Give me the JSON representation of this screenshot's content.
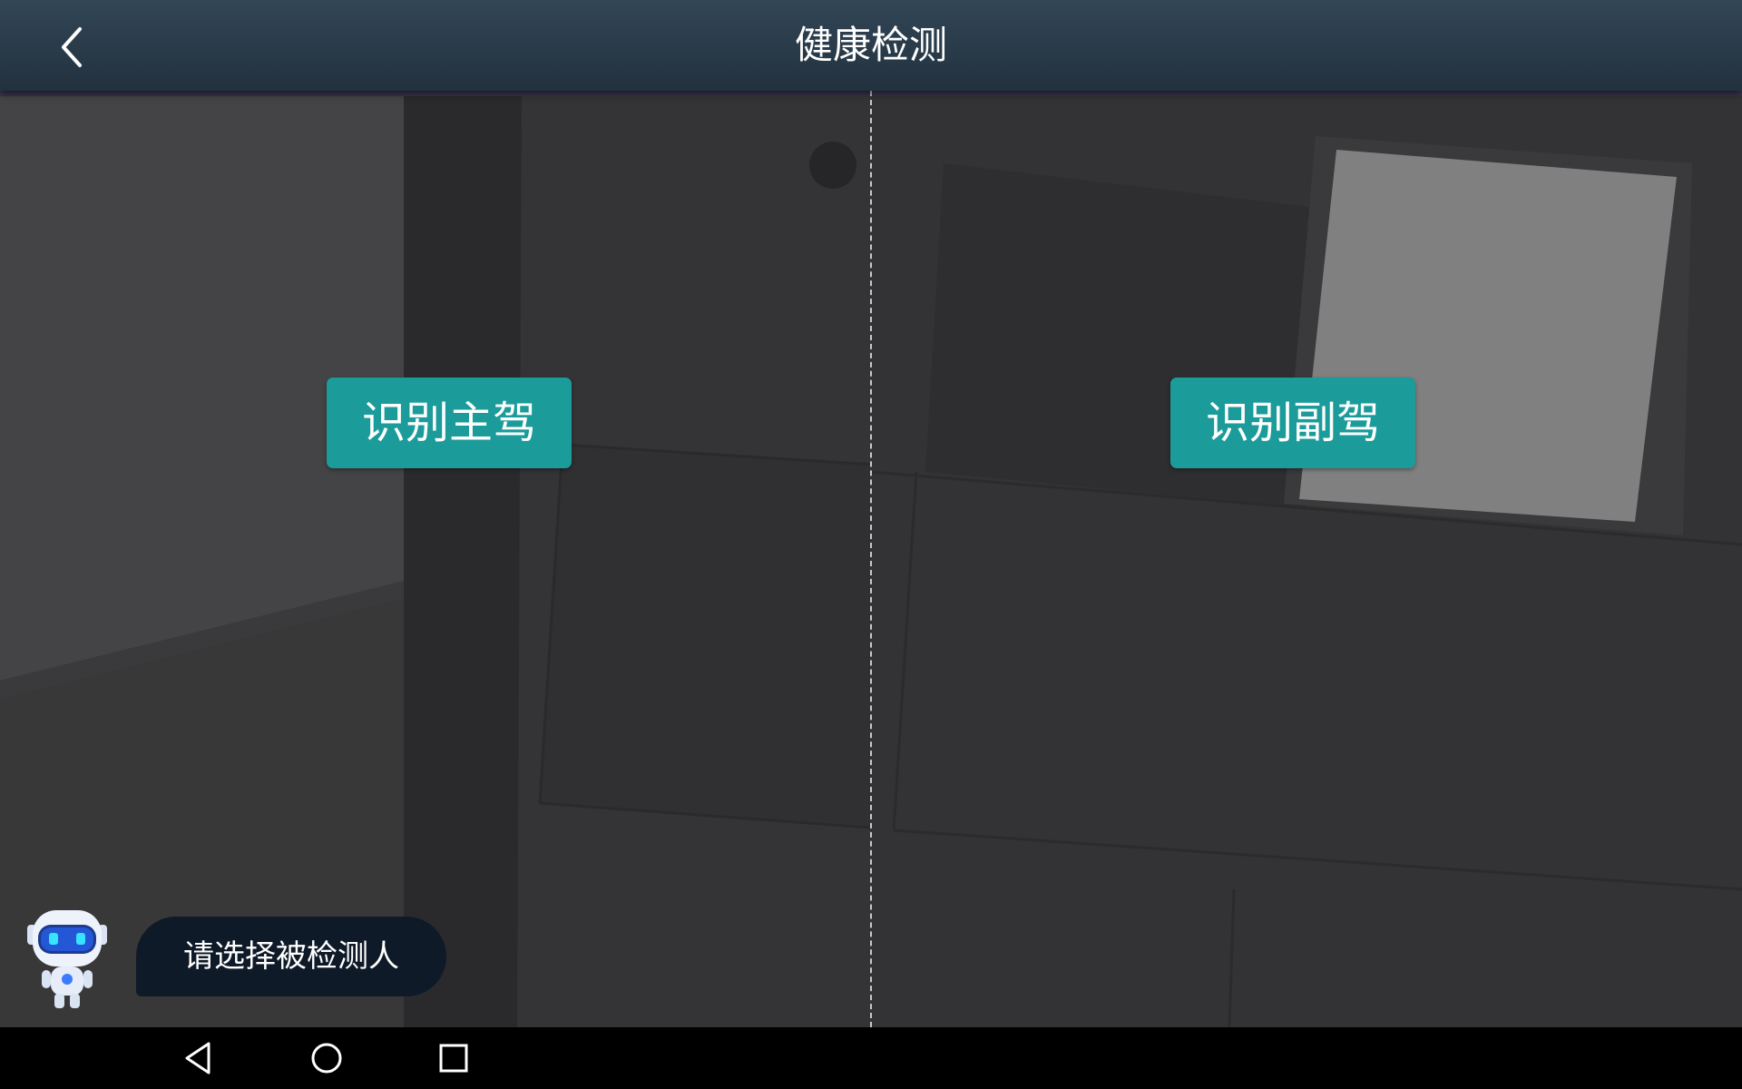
{
  "header": {
    "title": "健康检测",
    "back_icon": "chevron-left-icon"
  },
  "camera": {
    "primary_button_label": "识别主驾",
    "secondary_button_label": "识别副驾"
  },
  "assistant": {
    "avatar_icon": "robot-assistant-icon",
    "message": "请选择被检测人"
  },
  "navbar": {
    "back_icon": "nav-back-icon",
    "home_icon": "nav-home-icon",
    "recents_icon": "nav-recents-icon"
  },
  "colors": {
    "header_bg": "#2a3b49",
    "button_accent": "#1b9c9a",
    "bubble_bg": "#0f1a28",
    "navbar_bg": "#000000"
  }
}
